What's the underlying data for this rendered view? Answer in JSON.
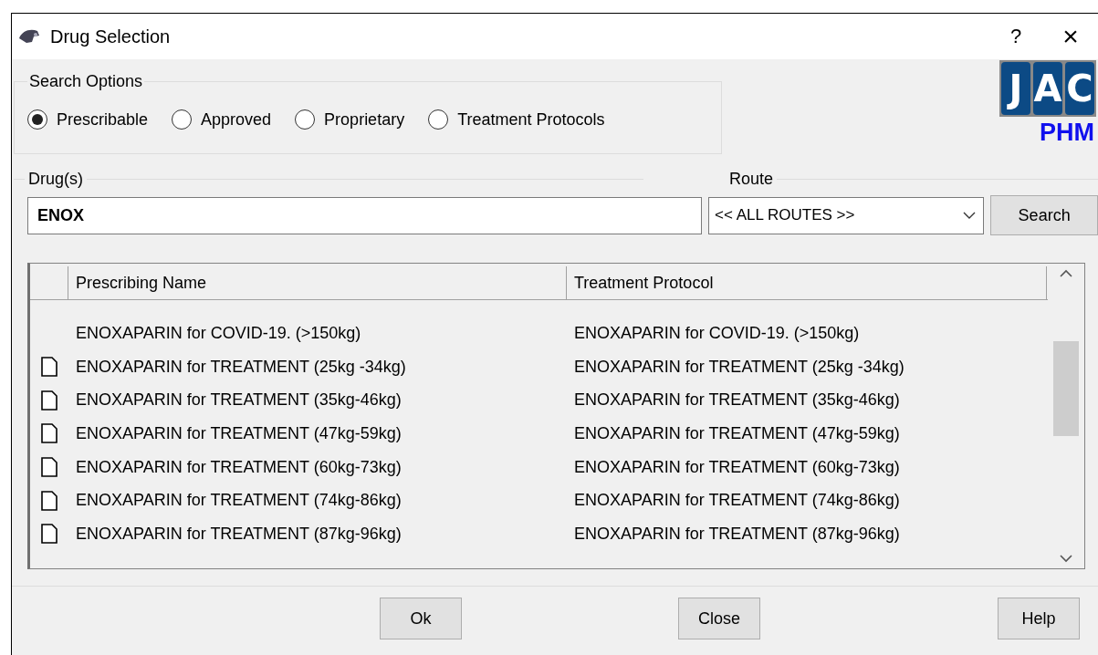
{
  "window": {
    "title": "Drug Selection",
    "help": "?",
    "close": "×"
  },
  "search_options": {
    "title": "Search Options",
    "options": [
      {
        "label": "Prescribable",
        "selected": true
      },
      {
        "label": "Approved",
        "selected": false
      },
      {
        "label": "Proprietary",
        "selected": false
      },
      {
        "label": "Treatment Protocols",
        "selected": false
      }
    ]
  },
  "logo": {
    "letters": [
      "J",
      "A",
      "C"
    ],
    "caption": "PHM"
  },
  "drugs": {
    "label": "Drug(s)",
    "value": "ENOX"
  },
  "route": {
    "label": "Route",
    "value": "<< ALL ROUTES >>"
  },
  "search_button": "Search",
  "table": {
    "columns": [
      "Prescribing Name",
      "Treatment Protocol"
    ],
    "rows": [
      {
        "document": false,
        "cells": [
          "ENOXAPARIN for COVID-19. (>150kg)",
          "ENOXAPARIN for COVID-19. (>150kg)"
        ]
      },
      {
        "document": true,
        "cells": [
          "ENOXAPARIN for TREATMENT (25kg -34kg)",
          "ENOXAPARIN for TREATMENT (25kg -34kg)"
        ]
      },
      {
        "document": true,
        "cells": [
          "ENOXAPARIN for TREATMENT (35kg-46kg)",
          "ENOXAPARIN for TREATMENT (35kg-46kg)"
        ]
      },
      {
        "document": true,
        "cells": [
          "ENOXAPARIN for TREATMENT (47kg-59kg)",
          "ENOXAPARIN for TREATMENT (47kg-59kg)"
        ]
      },
      {
        "document": true,
        "cells": [
          "ENOXAPARIN for TREATMENT (60kg-73kg)",
          "ENOXAPARIN for TREATMENT (60kg-73kg)"
        ]
      },
      {
        "document": true,
        "cells": [
          "ENOXAPARIN for TREATMENT (74kg-86kg)",
          "ENOXAPARIN for TREATMENT (74kg-86kg)"
        ]
      },
      {
        "document": true,
        "cells": [
          "ENOXAPARIN for TREATMENT (87kg-96kg)",
          "ENOXAPARIN for TREATMENT (87kg-96kg)"
        ]
      }
    ]
  },
  "buttons": [
    "Ok",
    "Close",
    "Help"
  ]
}
